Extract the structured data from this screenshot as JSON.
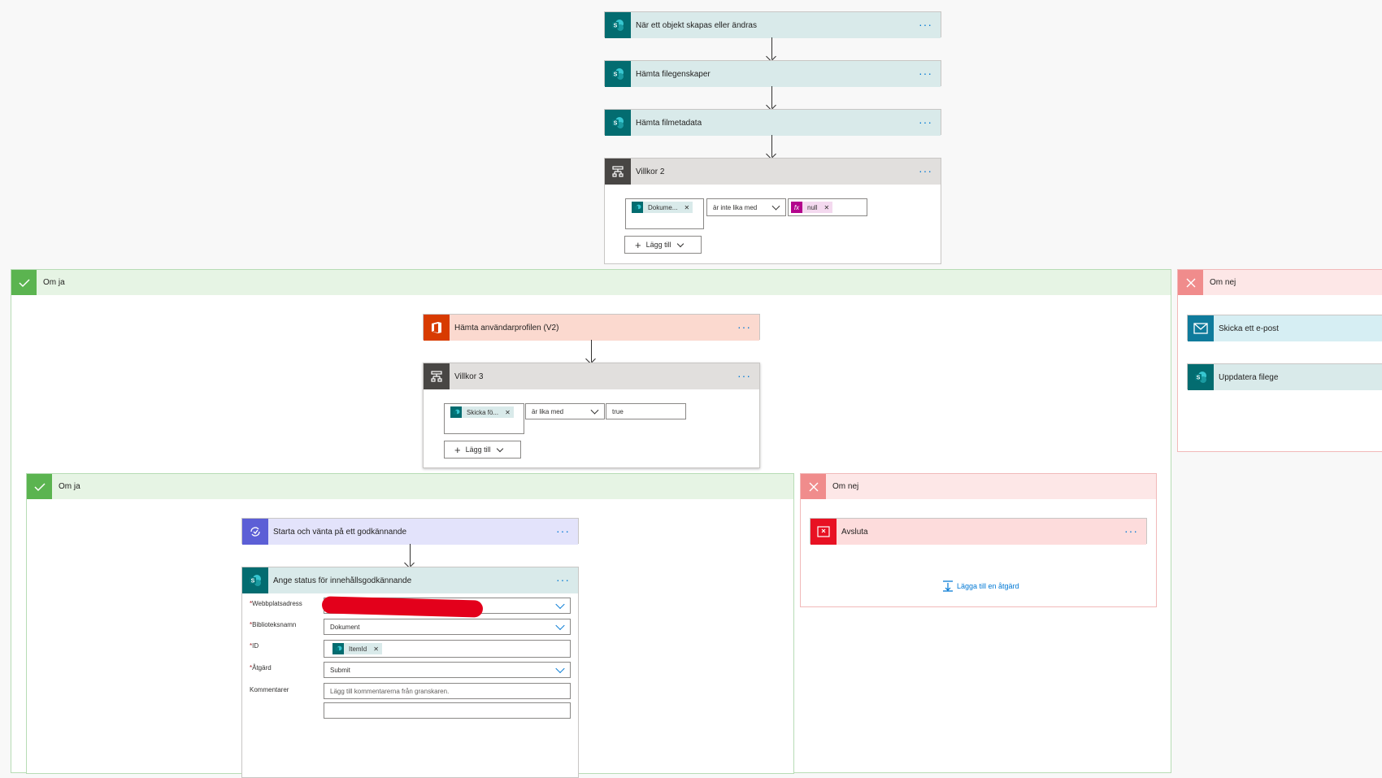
{
  "trigger": {
    "title": "När ett objekt skapas eller ändras",
    "more": "···"
  },
  "get_properties": {
    "title": "Hämta filegenskaper",
    "more": "···"
  },
  "get_metadata": {
    "title": "Hämta filmetadata",
    "more": "···"
  },
  "condition2": {
    "title": "Villkor 2",
    "more": "···",
    "left_token": "Dokume...",
    "operator": "är inte lika med",
    "right_token": "null",
    "add_label": "Lägg till"
  },
  "outer_yes": {
    "label": "Om ja"
  },
  "outer_no": {
    "label": "Om nej",
    "send_email": "Skicka ett e-post",
    "update_props": "Uppdatera filege"
  },
  "get_profile": {
    "title": "Hämta användarprofilen (V2)",
    "more": "···"
  },
  "condition3": {
    "title": "Villkor 3",
    "more": "···",
    "left_token": "Skicka fö...",
    "operator": "är lika med",
    "right_value": "true",
    "add_label": "Lägg till"
  },
  "inner_yes": {
    "label": "Om ja"
  },
  "inner_no": {
    "label": "Om nej",
    "add_action": "Lägga till en åtgärd"
  },
  "approval": {
    "title": "Starta och vänta på ett godkännande",
    "more": "···"
  },
  "terminate": {
    "title": "Avsluta",
    "more": "···"
  },
  "set_status": {
    "title": "Ange status för innehållsgodkännande",
    "more": "···",
    "fields": {
      "site_label": "Webbplatsadress",
      "library_label": "Biblioteksnamn",
      "library_value": "Dokument",
      "id_label": "ID",
      "id_token": "ItemId",
      "action_label": "Åtgärd",
      "action_value": "Submit",
      "comments_label": "Kommentarer",
      "comments_placeholder": "Lägg till kommentarerna från granskaren."
    },
    "required_mark": "*"
  },
  "colors": {
    "sharepoint": "#036c70",
    "condition": "#484644",
    "office365": "#d83b01",
    "approval": "#5c5fd6",
    "terminate": "#e81123",
    "yes": "#5bb450",
    "no": "#f08c8c",
    "link": "#0078d4"
  }
}
